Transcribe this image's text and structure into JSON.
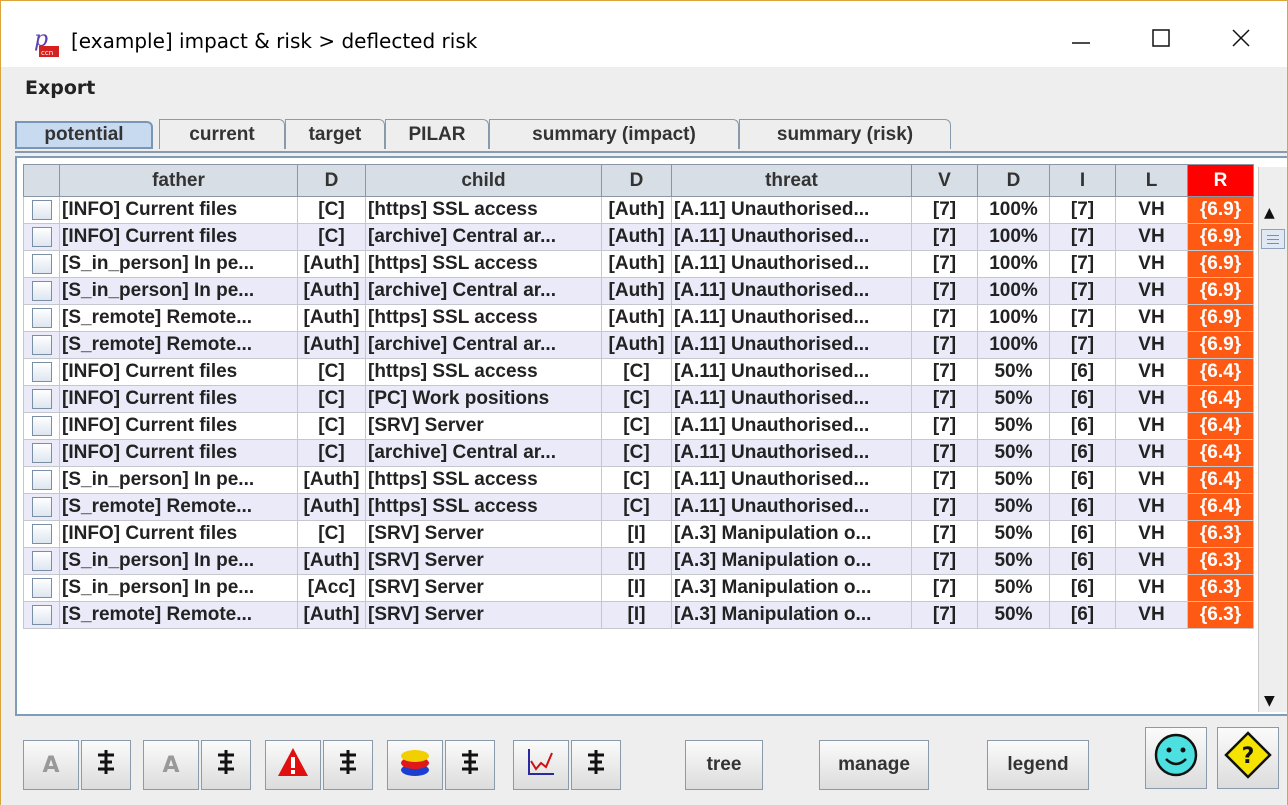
{
  "window": {
    "title": "[example] impact & risk > deflected risk",
    "icon": "pilar-app-icon",
    "controls": [
      "minimize-icon",
      "maximize-icon",
      "close-icon"
    ]
  },
  "menu": {
    "export_label": "Export"
  },
  "tabs": [
    {
      "label": "potential",
      "active": true
    },
    {
      "label": "current",
      "active": false
    },
    {
      "label": "target",
      "active": false
    },
    {
      "label": "PILAR",
      "active": false
    },
    {
      "label": "summary (impact)",
      "active": false
    },
    {
      "label": "summary (risk)",
      "active": false
    }
  ],
  "table": {
    "headers": {
      "father": "father",
      "d1": "D",
      "child": "child",
      "d2": "D",
      "threat": "threat",
      "v": "V",
      "d3": "D",
      "i": "I",
      "l": "L",
      "r": "R"
    },
    "rows": [
      {
        "father": "[INFO] Current files",
        "d1": "[C]",
        "child": "[https] SSL access",
        "d2": "[Auth]",
        "threat": "[A.11] Unauthorised...",
        "v": "[7]",
        "d3": "100%",
        "i": "[7]",
        "l": "VH",
        "r": "{6.9}"
      },
      {
        "father": "[INFO] Current files",
        "d1": "[C]",
        "child": "[archive] Central ar...",
        "d2": "[Auth]",
        "threat": "[A.11] Unauthorised...",
        "v": "[7]",
        "d3": "100%",
        "i": "[7]",
        "l": "VH",
        "r": "{6.9}"
      },
      {
        "father": "[S_in_person] In pe...",
        "d1": "[Auth]",
        "child": "[https] SSL access",
        "d2": "[Auth]",
        "threat": "[A.11] Unauthorised...",
        "v": "[7]",
        "d3": "100%",
        "i": "[7]",
        "l": "VH",
        "r": "{6.9}"
      },
      {
        "father": "[S_in_person] In pe...",
        "d1": "[Auth]",
        "child": "[archive] Central ar...",
        "d2": "[Auth]",
        "threat": "[A.11] Unauthorised...",
        "v": "[7]",
        "d3": "100%",
        "i": "[7]",
        "l": "VH",
        "r": "{6.9}"
      },
      {
        "father": "[S_remote] Remote...",
        "d1": "[Auth]",
        "child": "[https] SSL access",
        "d2": "[Auth]",
        "threat": "[A.11] Unauthorised...",
        "v": "[7]",
        "d3": "100%",
        "i": "[7]",
        "l": "VH",
        "r": "{6.9}"
      },
      {
        "father": "[S_remote] Remote...",
        "d1": "[Auth]",
        "child": "[archive] Central ar...",
        "d2": "[Auth]",
        "threat": "[A.11] Unauthorised...",
        "v": "[7]",
        "d3": "100%",
        "i": "[7]",
        "l": "VH",
        "r": "{6.9}"
      },
      {
        "father": "[INFO] Current files",
        "d1": "[C]",
        "child": "[https] SSL access",
        "d2": "[C]",
        "threat": "[A.11] Unauthorised...",
        "v": "[7]",
        "d3": "50%",
        "i": "[6]",
        "l": "VH",
        "r": "{6.4}"
      },
      {
        "father": "[INFO] Current files",
        "d1": "[C]",
        "child": "[PC] Work positions",
        "d2": "[C]",
        "threat": "[A.11] Unauthorised...",
        "v": "[7]",
        "d3": "50%",
        "i": "[6]",
        "l": "VH",
        "r": "{6.4}"
      },
      {
        "father": "[INFO] Current files",
        "d1": "[C]",
        "child": "[SRV] Server",
        "d2": "[C]",
        "threat": "[A.11] Unauthorised...",
        "v": "[7]",
        "d3": "50%",
        "i": "[6]",
        "l": "VH",
        "r": "{6.4}"
      },
      {
        "father": "[INFO] Current files",
        "d1": "[C]",
        "child": "[archive] Central ar...",
        "d2": "[C]",
        "threat": "[A.11] Unauthorised...",
        "v": "[7]",
        "d3": "50%",
        "i": "[6]",
        "l": "VH",
        "r": "{6.4}"
      },
      {
        "father": "[S_in_person] In pe...",
        "d1": "[Auth]",
        "child": "[https] SSL access",
        "d2": "[C]",
        "threat": "[A.11] Unauthorised...",
        "v": "[7]",
        "d3": "50%",
        "i": "[6]",
        "l": "VH",
        "r": "{6.4}"
      },
      {
        "father": "[S_remote] Remote...",
        "d1": "[Auth]",
        "child": "[https] SSL access",
        "d2": "[C]",
        "threat": "[A.11] Unauthorised...",
        "v": "[7]",
        "d3": "50%",
        "i": "[6]",
        "l": "VH",
        "r": "{6.4}"
      },
      {
        "father": "[INFO] Current files",
        "d1": "[C]",
        "child": "[SRV] Server",
        "d2": "[I]",
        "threat": "[A.3] Manipulation o...",
        "v": "[7]",
        "d3": "50%",
        "i": "[6]",
        "l": "VH",
        "r": "{6.3}"
      },
      {
        "father": "[S_in_person] In pe...",
        "d1": "[Auth]",
        "child": "[SRV] Server",
        "d2": "[I]",
        "threat": "[A.3] Manipulation o...",
        "v": "[7]",
        "d3": "50%",
        "i": "[6]",
        "l": "VH",
        "r": "{6.3}"
      },
      {
        "father": "[S_in_person] In pe...",
        "d1": "[Acc]",
        "child": "[SRV] Server",
        "d2": "[I]",
        "threat": "[A.3] Manipulation o...",
        "v": "[7]",
        "d3": "50%",
        "i": "[6]",
        "l": "VH",
        "r": "{6.3}"
      },
      {
        "father": "[S_remote] Remote...",
        "d1": "[Auth]",
        "child": "[SRV] Server",
        "d2": "[I]",
        "threat": "[A.3] Manipulation o...",
        "v": "[7]",
        "d3": "50%",
        "i": "[6]",
        "l": "VH",
        "r": "{6.3}"
      }
    ]
  },
  "toolbar": {
    "text_a_label": "A",
    "tree_label": "tree",
    "manage_label": "manage",
    "legend_label": "legend",
    "icons": [
      "font-a-icon",
      "tree-filter-icon",
      "warning-icon",
      "layers-icon",
      "chart-icon",
      "smiley-icon",
      "help-icon"
    ]
  },
  "colors": {
    "risk_header": "#ff0000",
    "risk_cell": "#ff5a14",
    "active_tab": "#c8daef",
    "row_alt": "#eaeaf9",
    "window_border": "#d9a43b"
  }
}
